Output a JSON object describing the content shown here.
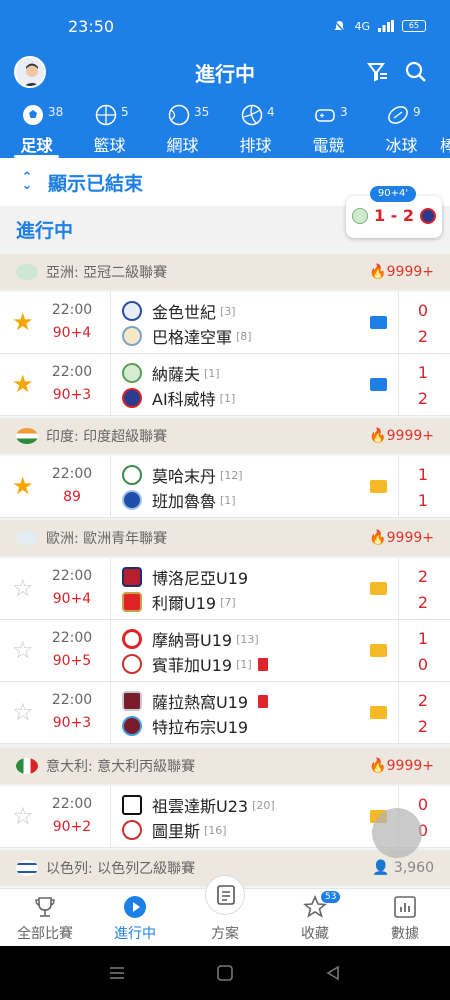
{
  "status": {
    "time": "23:50",
    "battery": "65",
    "signal": "4G"
  },
  "header": {
    "title": "進行中"
  },
  "tabs": [
    {
      "label": "足球",
      "count": "38"
    },
    {
      "label": "籃球",
      "count": "5"
    },
    {
      "label": "網球",
      "count": "35"
    },
    {
      "label": "排球",
      "count": "4"
    },
    {
      "label": "電競",
      "count": "3"
    },
    {
      "label": "冰球",
      "count": "9"
    },
    {
      "label": "棒",
      "count": ""
    }
  ],
  "show_finished": "顯示已結束",
  "floating_score": {
    "minute": "90+4'",
    "score": "1 - 2"
  },
  "section_title": "進行中",
  "leagues": [
    {
      "name": "亞洲: 亞冠二級聯賽",
      "hot": "9999+",
      "matches": [
        {
          "time": "22:00",
          "minute": "90+4",
          "starred": true,
          "badge": "tv",
          "home": {
            "name": "金色世紀",
            "rank": "[3]",
            "red": false
          },
          "away": {
            "name": "巴格達空軍",
            "rank": "[8]",
            "red": false
          },
          "home_score": "0",
          "away_score": "2"
        },
        {
          "time": "22:00",
          "minute": "90+3",
          "starred": true,
          "badge": "tv",
          "home": {
            "name": "納薩夫",
            "rank": "[1]",
            "red": false
          },
          "away": {
            "name": "AI科威特",
            "rank": "[1]",
            "red": false
          },
          "home_score": "1",
          "away_score": "2"
        }
      ]
    },
    {
      "name": "印度: 印度超級聯賽",
      "hot": "9999+",
      "matches": [
        {
          "time": "22:00",
          "minute": "89",
          "starred": true,
          "badge": "ani",
          "home": {
            "name": "莫哈末丹",
            "rank": "[12]",
            "red": false
          },
          "away": {
            "name": "班加魯魯",
            "rank": "[1]",
            "red": false
          },
          "home_score": "1",
          "away_score": "1"
        }
      ]
    },
    {
      "name": "歐洲: 歐洲青年聯賽",
      "hot": "9999+",
      "matches": [
        {
          "time": "22:00",
          "minute": "90+4",
          "starred": false,
          "badge": "ani",
          "home": {
            "name": "博洛尼亞U19",
            "rank": "",
            "red": false
          },
          "away": {
            "name": "利爾U19",
            "rank": "[7]",
            "red": false
          },
          "home_score": "2",
          "away_score": "2"
        },
        {
          "time": "22:00",
          "minute": "90+5",
          "starred": false,
          "badge": "ani",
          "home": {
            "name": "摩納哥U19",
            "rank": "[13]",
            "red": false
          },
          "away": {
            "name": "賓菲加U19",
            "rank": "[1]",
            "red": true
          },
          "home_score": "1",
          "away_score": "0"
        },
        {
          "time": "22:00",
          "minute": "90+3",
          "starred": false,
          "badge": "ani",
          "home": {
            "name": "薩拉熱窩U19",
            "rank": "",
            "red": true
          },
          "away": {
            "name": "特拉布宗U19",
            "rank": "",
            "red": false
          },
          "home_score": "2",
          "away_score": "2"
        }
      ]
    },
    {
      "name": "意大利: 意大利丙級聯賽",
      "hot": "9999+",
      "matches": [
        {
          "time": "22:00",
          "minute": "90+2",
          "starred": false,
          "badge": "ani",
          "home": {
            "name": "祖雲達斯U23",
            "rank": "[20]",
            "red": false
          },
          "away": {
            "name": "圖里斯",
            "rank": "[16]",
            "red": false
          },
          "home_score": "0",
          "away_score": "0"
        }
      ]
    },
    {
      "name": "以色列: 以色列乙級聯賽",
      "hot": "3,960",
      "matches": []
    }
  ],
  "bottom_nav": [
    {
      "label": "全部比賽",
      "icon": "trophy-icon"
    },
    {
      "label": "進行中",
      "icon": "play-circle-icon"
    },
    {
      "label": "方案",
      "icon": "plan-icon"
    },
    {
      "label": "收藏",
      "icon": "star-icon",
      "badge": "53"
    },
    {
      "label": "數據",
      "icon": "chart-icon"
    }
  ],
  "colors": {
    "primary": "#1e7fe6",
    "score_red": "#d8232a",
    "star": "#f6a600",
    "league_bg": "#ece8df"
  }
}
